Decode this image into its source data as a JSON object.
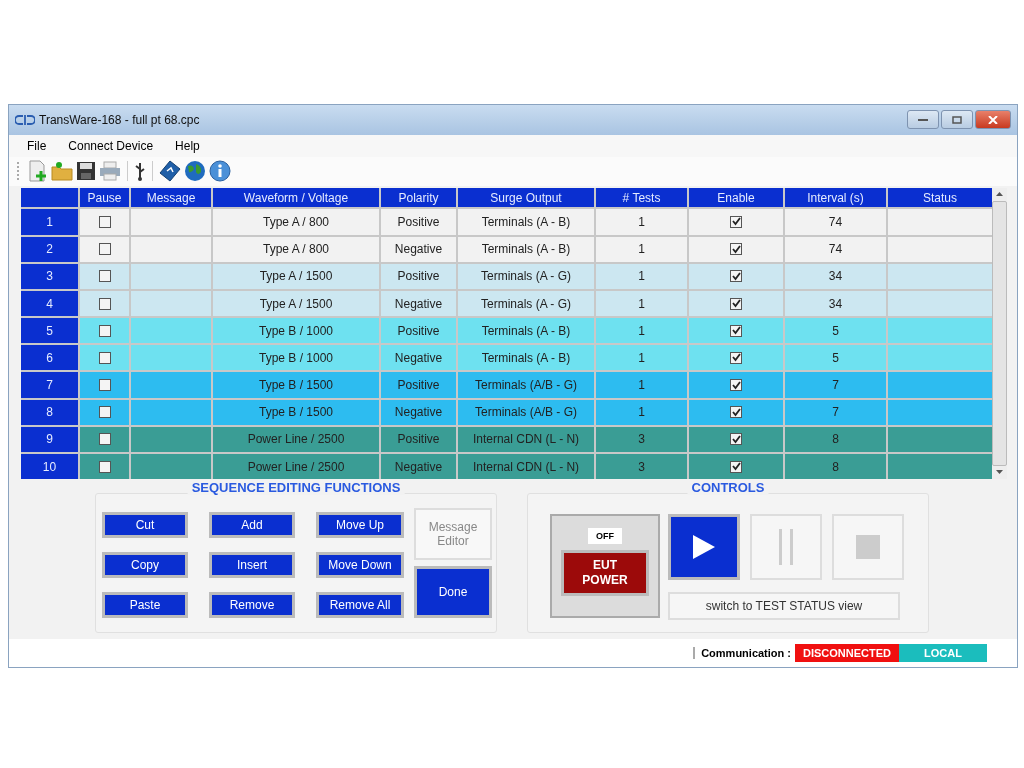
{
  "window": {
    "title": "TransWare-168 - full pt 68.cpc"
  },
  "menu": [
    {
      "label": "File"
    },
    {
      "label": "Connect Device"
    },
    {
      "label": "Help"
    }
  ],
  "toolbar": [
    {
      "kind": "new"
    },
    {
      "kind": "open"
    },
    {
      "kind": "save"
    },
    {
      "kind": "print"
    },
    {
      "kind": "usb"
    },
    {
      "kind": "book"
    },
    {
      "kind": "globe"
    },
    {
      "kind": "info"
    }
  ],
  "table": {
    "columns": [
      "Pause",
      "Message",
      "Waveform / Voltage",
      "Polarity",
      "Surge Output",
      "# Tests",
      "Enable",
      "Interval (s)",
      "Status"
    ],
    "rows": [
      {
        "number": "1",
        "pause": false,
        "waveform": "Type A / 800",
        "polarity": "Positive",
        "surge_output": "Terminals (A - B)",
        "tests": "1",
        "enable": true,
        "interval": "74",
        "color": "#f2f2f2"
      },
      {
        "number": "2",
        "pause": false,
        "waveform": "Type A / 800",
        "polarity": "Negative",
        "surge_output": "Terminals (A - B)",
        "tests": "1",
        "enable": true,
        "interval": "74",
        "color": "#f2f2f2"
      },
      {
        "number": "3",
        "pause": false,
        "waveform": "Type A / 1500",
        "polarity": "Positive",
        "surge_output": "Terminals (A - G)",
        "tests": "1",
        "enable": true,
        "interval": "34",
        "color": "#cce7f1"
      },
      {
        "number": "4",
        "pause": false,
        "waveform": "Type A / 1500",
        "polarity": "Negative",
        "surge_output": "Terminals (A - G)",
        "tests": "1",
        "enable": true,
        "interval": "34",
        "color": "#cce7f1"
      },
      {
        "number": "5",
        "pause": false,
        "waveform": "Type B / 1000",
        "polarity": "Positive",
        "surge_output": "Terminals (A - B)",
        "tests": "1",
        "enable": true,
        "interval": "5",
        "color": "#6ee1f0"
      },
      {
        "number": "6",
        "pause": false,
        "waveform": "Type B / 1000",
        "polarity": "Negative",
        "surge_output": "Terminals (A - B)",
        "tests": "1",
        "enable": true,
        "interval": "5",
        "color": "#6ee1f0"
      },
      {
        "number": "7",
        "pause": false,
        "waveform": "Type B / 1500",
        "polarity": "Positive",
        "surge_output": "Terminals (A/B - G)",
        "tests": "1",
        "enable": true,
        "interval": "7",
        "color": "#2dbcf0"
      },
      {
        "number": "8",
        "pause": false,
        "waveform": "Type B / 1500",
        "polarity": "Negative",
        "surge_output": "Terminals (A/B - G)",
        "tests": "1",
        "enable": true,
        "interval": "7",
        "color": "#2dbcf0"
      },
      {
        "number": "9",
        "pause": false,
        "waveform": "Power Line / 2500",
        "polarity": "Positive",
        "surge_output": "Internal CDN (L - N)",
        "tests": "3",
        "enable": true,
        "interval": "8",
        "color": "#3a9d95"
      },
      {
        "number": "10",
        "pause": false,
        "waveform": "Power Line / 2500",
        "polarity": "Negative",
        "surge_output": "Internal CDN (L - N)",
        "tests": "3",
        "enable": true,
        "interval": "8",
        "color": "#3a9d95"
      }
    ]
  },
  "sequence_editing": {
    "title": "SEQUENCE EDITING FUNCTIONS",
    "buttons": [
      {
        "label": "Cut",
        "disabled": false
      },
      {
        "label": "Add",
        "disabled": false
      },
      {
        "label": "Move Up",
        "disabled": false
      },
      {
        "label": "Copy",
        "disabled": false
      },
      {
        "label": "Insert",
        "disabled": false
      },
      {
        "label": "Move Down",
        "disabled": false
      },
      {
        "label": "Paste",
        "disabled": false
      },
      {
        "label": "Remove",
        "disabled": false
      },
      {
        "label": "Remove All",
        "disabled": false
      }
    ],
    "side_buttons": [
      {
        "label": "Message Editor",
        "disabled": true
      },
      {
        "label": "Done",
        "disabled": false
      }
    ]
  },
  "controls": {
    "title": "CONTROLS",
    "eut_indicator": "OFF",
    "eut_button": "EUT POWER",
    "transport": [
      {
        "kind": "play",
        "disabled": false
      },
      {
        "kind": "pause",
        "disabled": true
      },
      {
        "kind": "stop",
        "disabled": true
      }
    ],
    "switch_button": "switch to TEST STATUS view"
  },
  "status_bar": {
    "label": "Communication :",
    "connection": "DISCONNECTED",
    "mode": "LOCAL"
  }
}
